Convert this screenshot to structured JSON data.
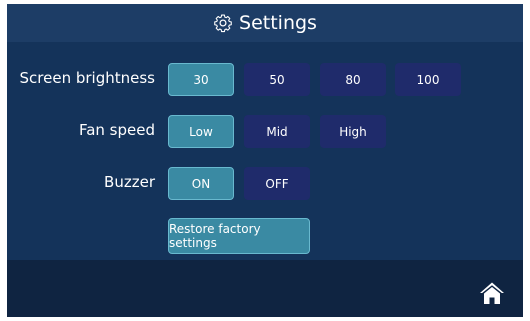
{
  "header": {
    "title": "Settings",
    "icon": "gear-icon"
  },
  "rows": {
    "brightness": {
      "label": "Screen brightness",
      "options": [
        "30",
        "50",
        "80",
        "100"
      ],
      "selected": "30"
    },
    "fan": {
      "label": "Fan speed",
      "options": [
        "Low",
        "Mid",
        "High"
      ],
      "selected": "Low"
    },
    "buzzer": {
      "label": "Buzzer",
      "options": [
        "ON",
        "OFF"
      ],
      "selected": "ON"
    }
  },
  "restore": {
    "label": "Restore factory settings"
  },
  "footer": {
    "home_icon": "home-icon"
  },
  "colors": {
    "background": "#0f2441",
    "header": "#1d3d66",
    "content": "#14335a",
    "active_button": "#3a8aa3",
    "inactive_button": "#1f2b6b"
  }
}
